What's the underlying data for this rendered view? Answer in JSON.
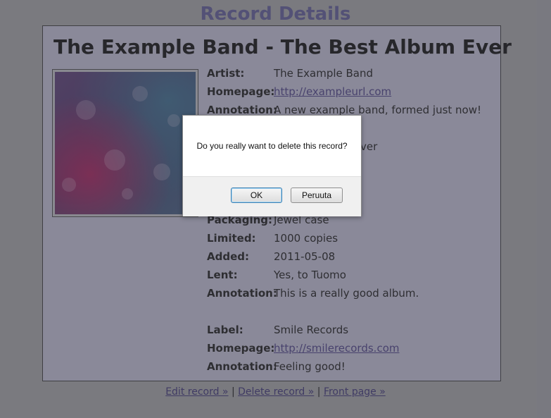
{
  "page": {
    "title": "Record Details"
  },
  "record": {
    "heading": "The Example Band - The Best Album Ever",
    "cover_alt": "Album cover"
  },
  "details": [
    {
      "label": "Artist:",
      "value": "The Example Band",
      "link": false
    },
    {
      "label": "Homepage:",
      "value": "http://exampleurl.com",
      "link": true
    },
    {
      "label": "Annotation:",
      "value": "A new example band, formed just now!",
      "link": false
    },
    {
      "label": "",
      "value": "",
      "link": false
    },
    {
      "label": "",
      "value": "ver",
      "link": false
    },
    {
      "label": "",
      "value": "",
      "link": false
    },
    {
      "label": "",
      "value": "",
      "link": false
    },
    {
      "label": "",
      "value": "",
      "link": false
    },
    {
      "label": "Packaging:",
      "value": "Jewel case",
      "link": false
    },
    {
      "label": "Limited:",
      "value": "1000 copies",
      "link": false
    },
    {
      "label": "Added:",
      "value": "2011-05-08",
      "link": false
    },
    {
      "label": "Lent:",
      "value": "Yes, to Tuomo",
      "link": false
    },
    {
      "label": "Annotation:",
      "value": "This is a really good album.",
      "link": false
    },
    {
      "label": "",
      "value": "",
      "link": false
    },
    {
      "label": "Label:",
      "value": "Smile Records",
      "link": false
    },
    {
      "label": "Homepage:",
      "value": "http://smilerecords.com",
      "link": true
    },
    {
      "label": "Annotation:",
      "value": "Feeling good!",
      "link": false
    }
  ],
  "footer": {
    "edit_label": "Edit record »",
    "delete_label": "Delete record »",
    "front_label": "Front page »",
    "separator": "|"
  },
  "dialog": {
    "message": "Do you really want to delete this record?",
    "ok_label": "OK",
    "cancel_label": "Peruuta"
  },
  "colors": {
    "title": "#6e6aa6",
    "panel_background": "#d2d0e6",
    "link": "#5a4f95",
    "overlay": "rgba(50,50,60,0.45)"
  }
}
